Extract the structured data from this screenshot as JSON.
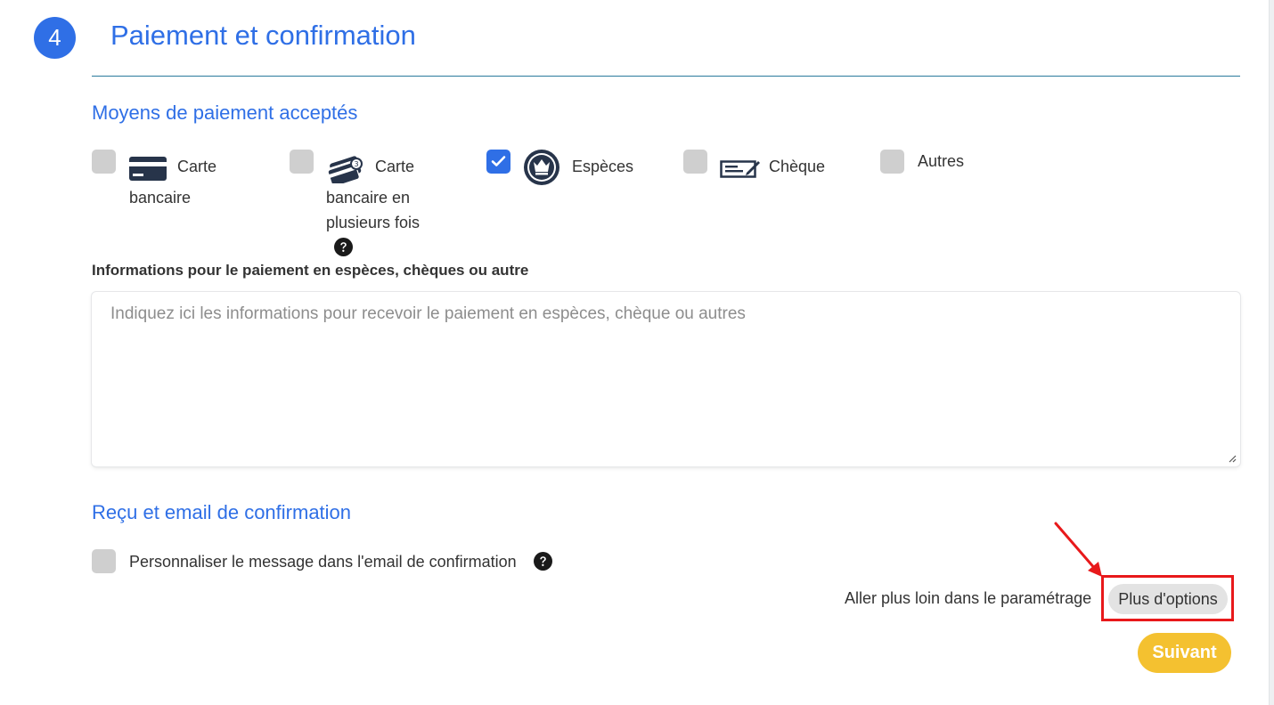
{
  "step": {
    "number": "4",
    "title": "Paiement et confirmation"
  },
  "payment_section": {
    "title": "Moyens de paiement acceptés",
    "methods": [
      {
        "line1": "Carte",
        "line2": "bancaire",
        "checked": false,
        "icon": "credit-card-icon"
      },
      {
        "line1": "Carte",
        "line2": "bancaire en",
        "line3": "plusieurs fois",
        "checked": false,
        "icon": "multiple-cards-icon",
        "help_icon": "question-circle-icon"
      },
      {
        "line1": "Espèces",
        "checked": true,
        "icon": "crown-coin-icon"
      },
      {
        "line1": "Chèque",
        "checked": false,
        "icon": "check-paper-icon"
      },
      {
        "line1": "Autres",
        "checked": false
      }
    ]
  },
  "info_field": {
    "label": "Informations pour le paiement en espèces, chèques ou autre",
    "value": "",
    "placeholder": "Indiquez ici les informations pour recevoir le paiement en espèces, chèque ou autres"
  },
  "confirmation_section": {
    "title": "Reçu et email de confirmation",
    "customize_label": "Personnaliser le message dans l'email de confirmation",
    "customize_checked": false,
    "help_icon": "question-circle-icon"
  },
  "advanced": {
    "label": "Aller plus loin dans le paramétrage",
    "button_label": "Plus d'options"
  },
  "next_button": {
    "label": "Suivant"
  },
  "colors": {
    "accent": "#2f6fe6",
    "next_button": "#f4c130",
    "highlight": "#e8191b"
  }
}
